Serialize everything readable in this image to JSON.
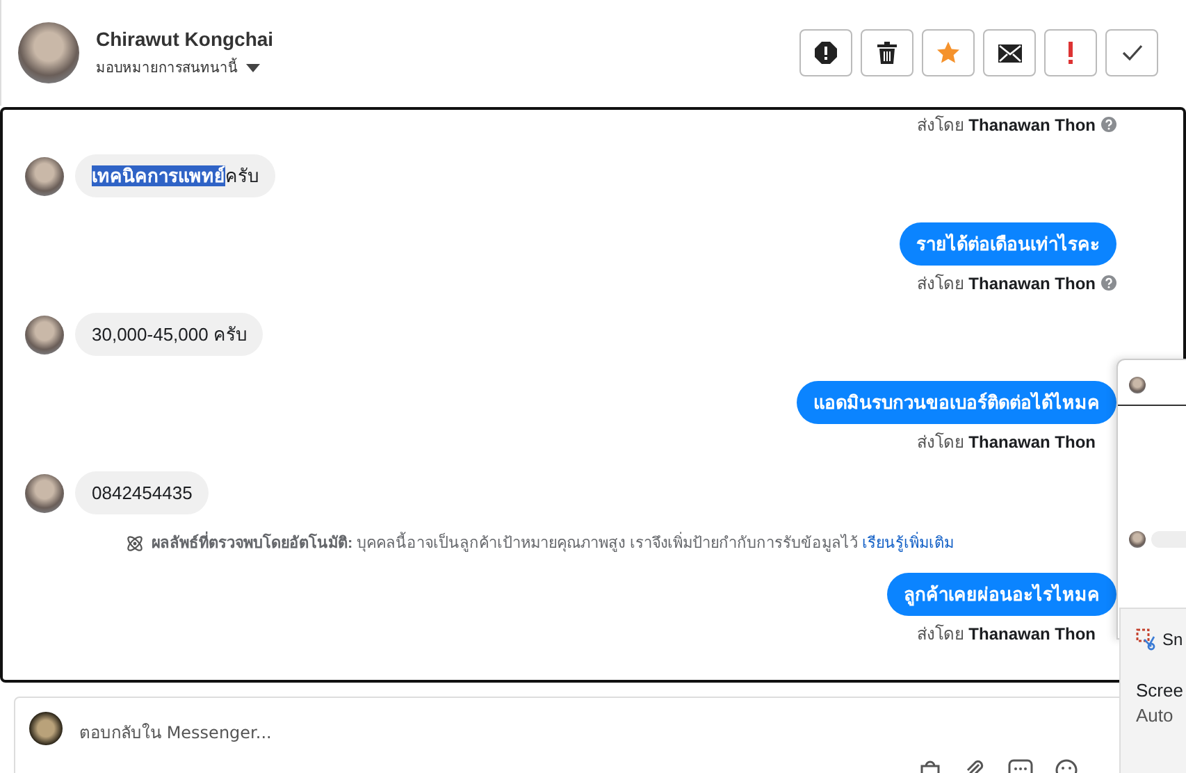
{
  "header": {
    "name": "Chirawut Kongchai",
    "assign_label": "มอบหมายการสนทนานี้"
  },
  "actions": [
    {
      "kind": "spam"
    },
    {
      "kind": "delete"
    },
    {
      "kind": "star"
    },
    {
      "kind": "unread"
    },
    {
      "kind": "important"
    },
    {
      "kind": "done"
    }
  ],
  "messages": [
    {
      "kind": "sender",
      "prefix": "ส่งโดย",
      "name": "Thanawan Thon",
      "info_icon": true
    },
    {
      "kind": "received",
      "parts": [
        {
          "text": "เทคนิคการแพทย์",
          "selected": true
        },
        {
          "text": "ครับ",
          "selected": false
        }
      ]
    },
    {
      "kind": "sent",
      "text": "รายได้ต่อเดือนเท่าไรคะ"
    },
    {
      "kind": "sender",
      "prefix": "ส่งโดย",
      "name": "Thanawan Thon",
      "info_icon": true
    },
    {
      "kind": "received",
      "parts": [
        {
          "text": "30,000-45,000 ครับ",
          "selected": false
        }
      ]
    },
    {
      "kind": "sent",
      "text": "แอดมินรบกวนขอเบอร์ติดต่อได้ไหมค"
    },
    {
      "kind": "sender",
      "prefix": "ส่งโดย",
      "name": "Thanawan Thon",
      "info_icon": false
    },
    {
      "kind": "received",
      "parts": [
        {
          "text": "0842454435",
          "selected": false
        }
      ]
    },
    {
      "kind": "notice",
      "text": "**ผลลัพธ์ที่ตรวจพบโดยอัตโนมัติ:** บุคคลนี้อาจเป็นลูกค้าเป้าหมายคุณภาพสูง เราจึงเพิ่มป้ายกำกับการรับข้อมูลไว้",
      "link": "เรียนรู้เพิ่มเติม"
    },
    {
      "kind": "sent",
      "text": "ลูกค้าเคยผ่อนอะไรไหมค"
    },
    {
      "kind": "sender",
      "prefix": "ส่งโดย",
      "name": "Thanawan Thon",
      "info_icon": false
    }
  ],
  "composer": {
    "placeholder": "ตอบกลับใน Messenger..."
  },
  "notification": {
    "app": "Sn",
    "title": "Scree",
    "body": "Auto"
  }
}
